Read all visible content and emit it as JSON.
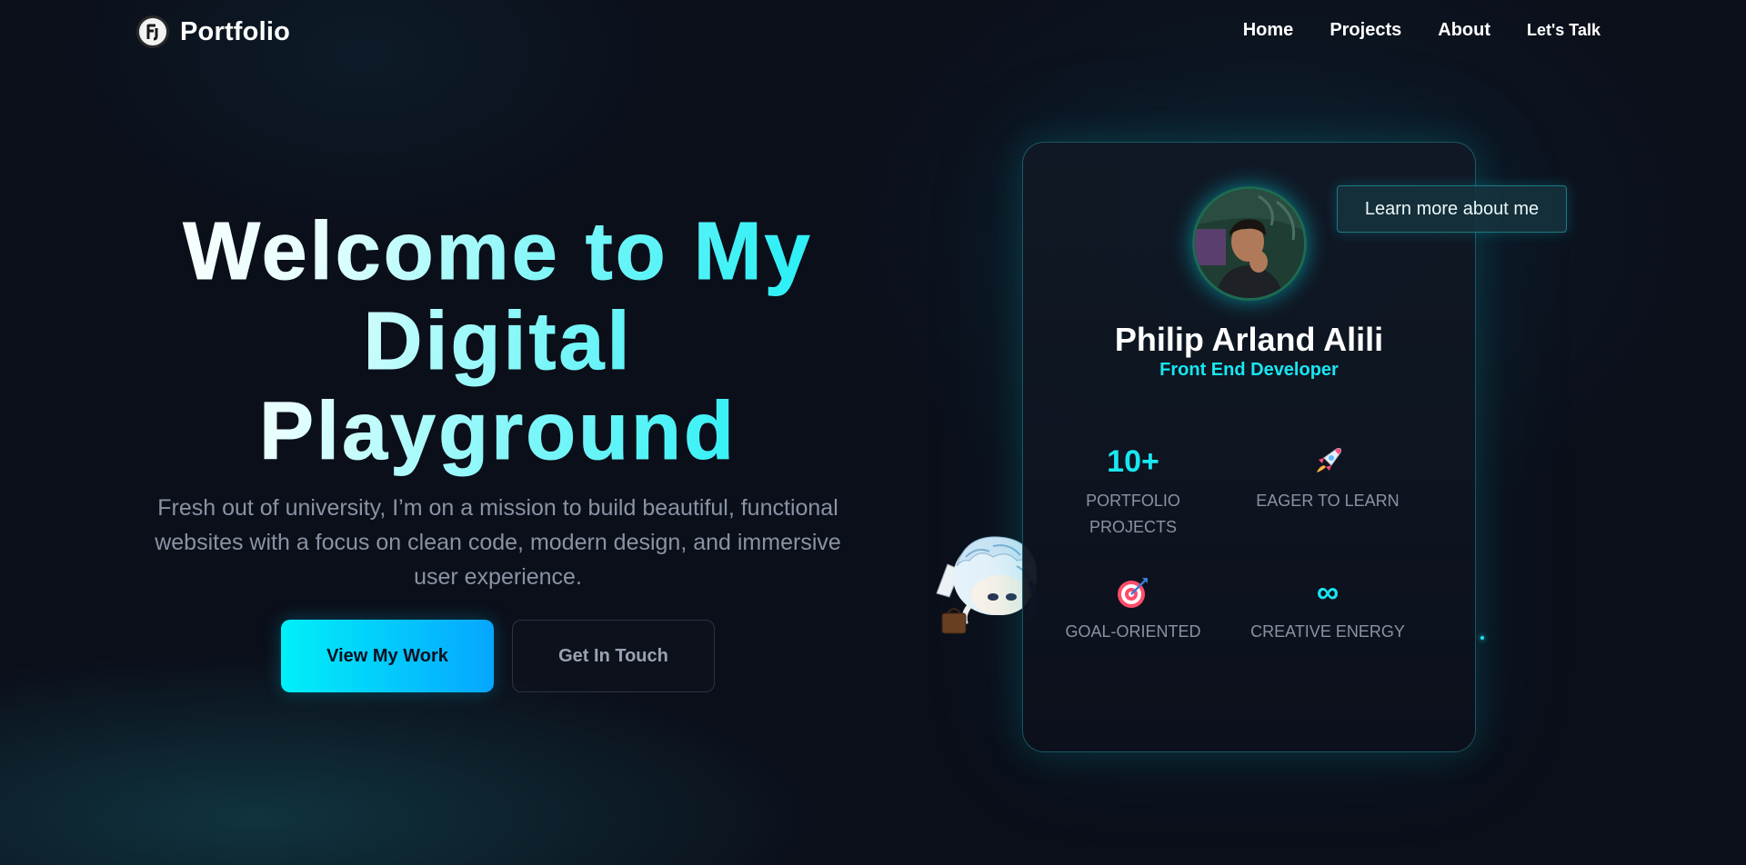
{
  "nav": {
    "brand": "Portfolio",
    "logo_icon": "portfolio-logo-icon",
    "links": [
      "Home",
      "Projects",
      "About"
    ],
    "cta": "Let's Talk"
  },
  "hero": {
    "title_line1": "Welcome to My",
    "title_line2": "Digital",
    "title_line3": "Playground",
    "subtitle": "Fresh out of university, I’m on a mission to build beautiful, functional websites with a focus on clean code, modern design, and immersive user experience.",
    "primary_button": "View My Work",
    "secondary_button": "Get In Touch"
  },
  "profile": {
    "name": "Philip Arland Alili",
    "role": "Front End Developer",
    "learn_more": "Learn more about me",
    "stats": [
      {
        "value": "10+",
        "label": "PORTFOLIO PROJECTS"
      },
      {
        "icon": "rocket-icon",
        "label": "EAGER TO LEARN"
      },
      {
        "icon": "target-icon",
        "label": "GOAL-ORIENTED"
      },
      {
        "value": "∞",
        "label": "CREATIVE ENERGY"
      }
    ]
  },
  "colors": {
    "background": "#0b0f1a",
    "accent": "#19e6f0",
    "button_gradient_start": "#00f0f8",
    "button_gradient_end": "#06a6ff",
    "muted_text": "#8a93a3"
  }
}
